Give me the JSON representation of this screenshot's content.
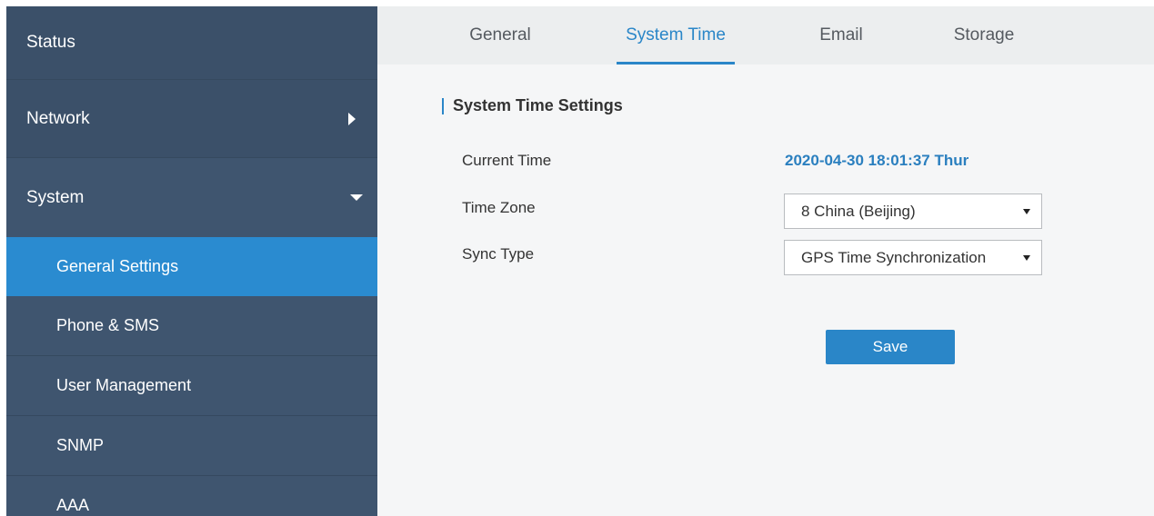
{
  "sidebar": {
    "items": [
      {
        "label": "Status"
      },
      {
        "label": "Network"
      },
      {
        "label": "System"
      },
      {
        "label": "General Settings"
      },
      {
        "label": "Phone & SMS"
      },
      {
        "label": "User Management"
      },
      {
        "label": "SNMP"
      },
      {
        "label": "AAA"
      }
    ]
  },
  "tabs": [
    {
      "label": "General"
    },
    {
      "label": "System Time"
    },
    {
      "label": "Email"
    },
    {
      "label": "Storage"
    }
  ],
  "section": {
    "title": "System Time Settings"
  },
  "form": {
    "current_time_label": "Current Time",
    "current_time_value": "2020-04-30 18:01:37 Thur",
    "time_zone_label": "Time Zone",
    "time_zone_value": "8 China (Beijing)",
    "sync_type_label": "Sync Type",
    "sync_type_value": "GPS Time Synchronization",
    "save_label": "Save"
  },
  "colors": {
    "sidebar_bg": "#3f556f",
    "active_item": "#2a8bd0",
    "accent": "#2a86c8"
  }
}
